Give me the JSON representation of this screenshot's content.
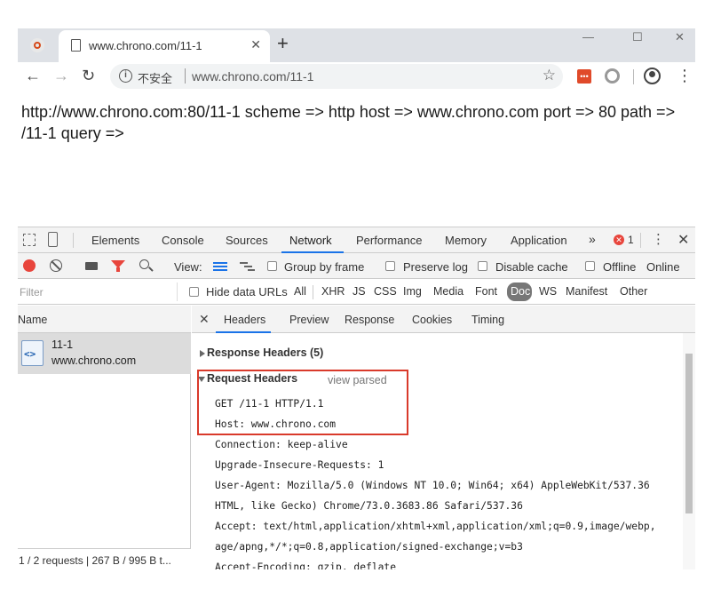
{
  "browser": {
    "tab_title": "www.chrono.com/11-1",
    "omnibox": {
      "security_label": "不安全",
      "url": "www.chrono.com/11-1"
    }
  },
  "page": {
    "text": "http://www.chrono.com:80/11-1 scheme => http host => www.chrono.com port => 80 path => /11-1 query =>"
  },
  "devtools": {
    "panels": [
      "Elements",
      "Console",
      "Sources",
      "Network",
      "Performance",
      "Memory",
      "Application"
    ],
    "active_panel": "Network",
    "error_count": "1",
    "toolbar": {
      "view_label": "View:",
      "group_by_frame": "Group by frame",
      "preserve_log": "Preserve log",
      "disable_cache": "Disable cache",
      "offline": "Offline",
      "online": "Online"
    },
    "filter": {
      "placeholder": "Filter",
      "hide_data_urls": "Hide data URLs",
      "types": [
        "All",
        "XHR",
        "JS",
        "CSS",
        "Img",
        "Media",
        "Font",
        "Doc",
        "WS",
        "Manifest",
        "Other"
      ],
      "selected_type": "Doc"
    },
    "request_list": {
      "header": "Name",
      "rows": [
        {
          "icon_text": "<>",
          "name": "11-1",
          "host": "www.chrono.com"
        }
      ],
      "status": "1 / 2 requests | 267 B / 995 B t..."
    },
    "detail": {
      "tabs": [
        "Headers",
        "Preview",
        "Response",
        "Cookies",
        "Timing"
      ],
      "active_tab": "Headers",
      "response_headers_label": "Response Headers (5)",
      "request_headers_label": "Request Headers",
      "view_parsed": "view parsed",
      "request_lines": [
        "GET /11-1 HTTP/1.1",
        "Host: www.chrono.com",
        "Connection: keep-alive",
        "Upgrade-Insecure-Requests: 1",
        "User-Agent: Mozilla/5.0 (Windows NT 10.0; Win64; x64) AppleWebKit/537.36",
        "HTML, like Gecko) Chrome/73.0.3683.86 Safari/537.36",
        "Accept: text/html,application/xhtml+xml,application/xml;q=0.9,image/webp,",
        "age/apng,*/*;q=0.8,application/signed-exchange;v=b3",
        "Accept-Encoding: gzip, deflate"
      ]
    }
  },
  "colors": {
    "accent": "#1a73e8",
    "record": "#e8453c",
    "highlight_box": "#d93a2b"
  }
}
